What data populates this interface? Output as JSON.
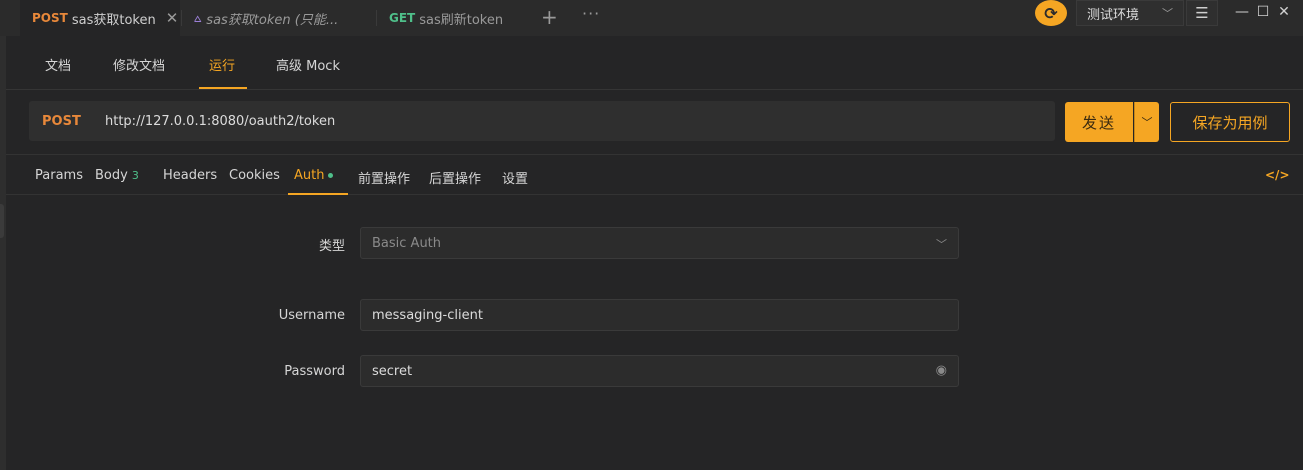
{
  "tabs": [
    {
      "method": "POST",
      "title": "sas获取token",
      "active": true
    },
    {
      "method": "",
      "title": "sas获取token (只能...",
      "active": false
    },
    {
      "method": "GET",
      "title": "sas刷新token",
      "active": false
    }
  ],
  "toolbar": {
    "plus": "+",
    "more": "···"
  },
  "environment": {
    "label": "测试环境"
  },
  "window": {
    "minimize": "—",
    "maximize": "☐",
    "close": "✕"
  },
  "subnav": [
    {
      "label": "文档"
    },
    {
      "label": "修改文档"
    },
    {
      "label": "运行",
      "active": true
    },
    {
      "label": "高级 Mock"
    }
  ],
  "request": {
    "method": "POST",
    "url": "http://127.0.0.1:8080/oauth2/token",
    "send_label": "发送",
    "save_label": "保存为用例"
  },
  "param_tabs": [
    {
      "label": "Params"
    },
    {
      "label": "Body",
      "count": "3"
    },
    {
      "label": "Headers"
    },
    {
      "label": "Cookies"
    },
    {
      "label": "Auth",
      "active": true,
      "dot": true
    },
    {
      "label": "前置操作"
    },
    {
      "label": "后置操作"
    },
    {
      "label": "设置"
    }
  ],
  "auth": {
    "type_label": "类型",
    "type_value": "Basic Auth",
    "username_label": "Username",
    "username_value": "messaging-client",
    "password_label": "Password",
    "password_value": "secret"
  },
  "colors": {
    "accent": "#f5a623",
    "post": "#e8883a",
    "get": "#4fbf8a",
    "background": "#252526"
  }
}
